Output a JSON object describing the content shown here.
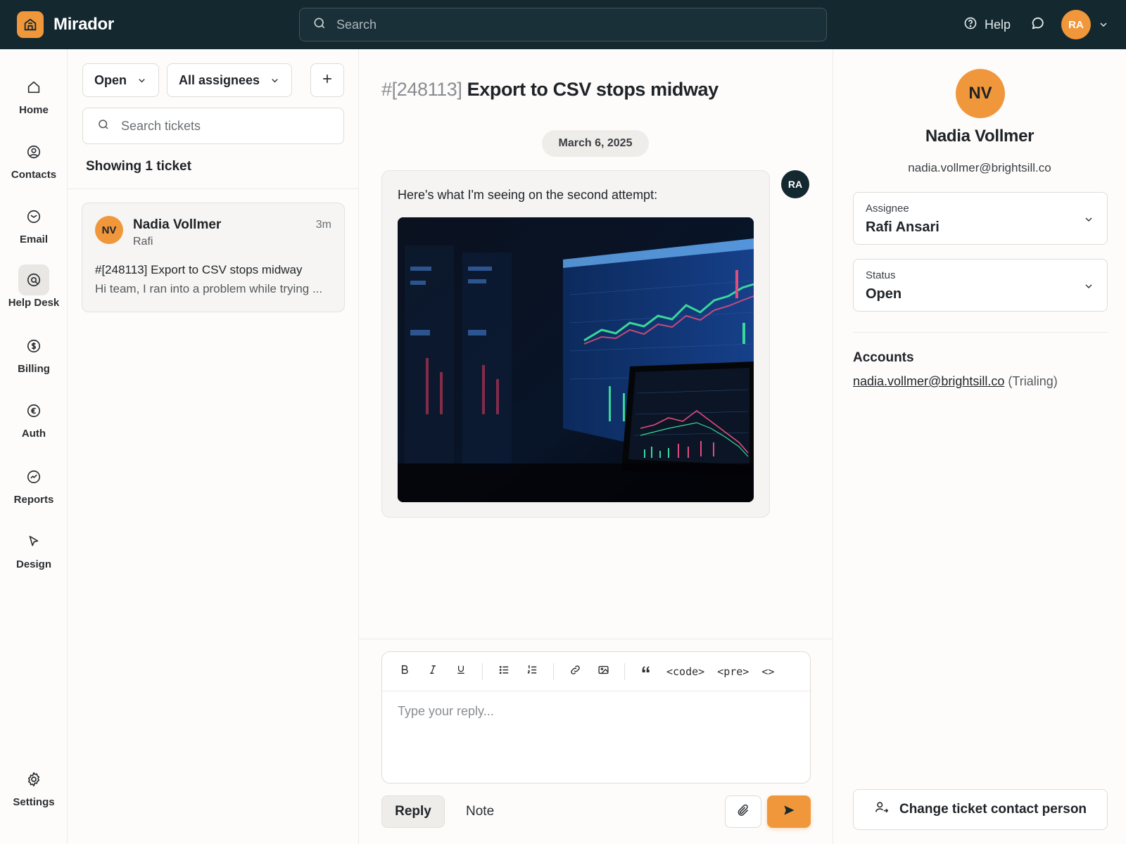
{
  "app": {
    "name": "Mirador",
    "search_placeholder": "Search",
    "help_label": "Help",
    "user_initials": "RA"
  },
  "nav": {
    "items": [
      {
        "label": "Home",
        "icon": "home-icon"
      },
      {
        "label": "Contacts",
        "icon": "user-circle-icon"
      },
      {
        "label": "Email",
        "icon": "mail-icon"
      },
      {
        "label": "Help Desk",
        "icon": "help-desk-icon",
        "active": true
      },
      {
        "label": "Billing",
        "icon": "dollar-icon"
      },
      {
        "label": "Auth",
        "icon": "euro-icon"
      },
      {
        "label": "Reports",
        "icon": "chart-icon"
      },
      {
        "label": "Design",
        "icon": "cursor-icon"
      }
    ],
    "settings_label": "Settings"
  },
  "ticket_list": {
    "status_filter": "Open",
    "assignee_filter": "All assignees",
    "search_placeholder": "Search tickets",
    "showing_text": "Showing 1 ticket",
    "tickets": [
      {
        "initials": "NV",
        "name": "Nadia Vollmer",
        "time": "3m",
        "assignee": "Rafi",
        "subject": "#[248113] Export to CSV stops midway",
        "preview": "Hi team, I ran into a problem while trying ..."
      }
    ]
  },
  "conversation": {
    "ticket_number": "#[248113]",
    "title": "Export to CSV stops midway",
    "date": "March 6, 2025",
    "message": {
      "text": "Here's what I'm seeing on the second attempt:",
      "author_initials": "RA"
    },
    "composer": {
      "placeholder": "Type your reply...",
      "code_label": "<code>",
      "pre_label": "<pre>",
      "html_label": "<>",
      "reply_tab": "Reply",
      "note_tab": "Note"
    }
  },
  "contact": {
    "initials": "NV",
    "name": "Nadia Vollmer",
    "email": "nadia.vollmer@brightsill.co",
    "assignee_label": "Assignee",
    "assignee_value": "Rafi Ansari",
    "status_label": "Status",
    "status_value": "Open",
    "accounts_heading": "Accounts",
    "account_email": "nadia.vollmer@brightsill.co",
    "account_status": "(Trialing)",
    "change_contact_label": "Change ticket contact person"
  },
  "colors": {
    "topbar": "#13282f",
    "accent": "#f0973b",
    "background": "#fdfcfb"
  }
}
